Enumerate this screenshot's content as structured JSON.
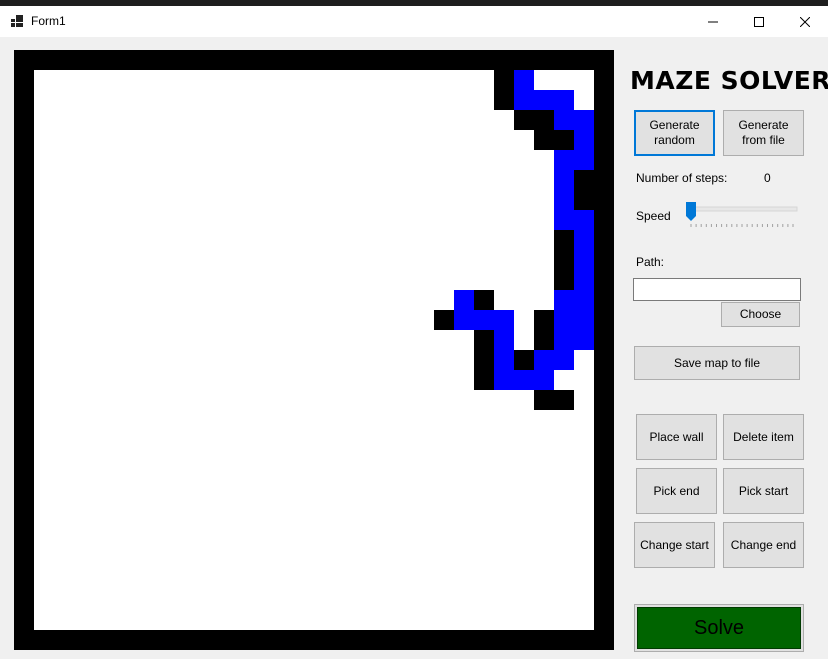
{
  "window": {
    "title": "Form1",
    "controls": {
      "minimize": "—",
      "maximize": "☐",
      "close": "✕"
    }
  },
  "maze": {
    "grid_size": 30,
    "colors": {
      "wall": "#000000",
      "path": "#0000ff",
      "empty": "#ffffff"
    },
    "walls": [
      [
        24,
        1
      ],
      [
        24,
        2
      ],
      [
        25,
        3
      ],
      [
        26,
        3
      ],
      [
        29,
        3
      ],
      [
        29,
        4
      ],
      [
        29,
        5
      ],
      [
        26,
        4
      ],
      [
        27,
        4
      ],
      [
        29,
        6
      ],
      [
        28,
        6
      ],
      [
        28,
        7
      ],
      [
        29,
        7
      ],
      [
        28,
        8
      ],
      [
        29,
        8
      ],
      [
        27,
        9
      ],
      [
        29,
        9
      ],
      [
        27,
        10
      ],
      [
        29,
        10
      ],
      [
        27,
        11
      ],
      [
        28,
        11
      ],
      [
        29,
        11
      ],
      [
        28,
        12
      ],
      [
        29,
        12
      ],
      [
        22,
        12
      ],
      [
        23,
        12
      ],
      [
        21,
        13
      ],
      [
        26,
        13
      ],
      [
        23,
        14
      ],
      [
        26,
        14
      ],
      [
        29,
        13
      ],
      [
        29,
        14
      ],
      [
        23,
        15
      ],
      [
        24,
        15
      ],
      [
        25,
        15
      ],
      [
        23,
        16
      ],
      [
        29,
        16
      ],
      [
        26,
        17
      ],
      [
        27,
        17
      ]
    ],
    "path": [
      [
        25,
        1
      ],
      [
        25,
        2
      ],
      [
        26,
        2
      ],
      [
        27,
        2
      ],
      [
        27,
        3
      ],
      [
        28,
        3
      ],
      [
        28,
        4
      ],
      [
        28,
        5
      ],
      [
        27,
        5
      ],
      [
        27,
        6
      ],
      [
        27,
        7
      ],
      [
        27,
        8
      ],
      [
        28,
        8
      ],
      [
        28,
        9
      ],
      [
        28,
        10
      ],
      [
        28,
        11
      ],
      [
        28,
        12
      ],
      [
        27,
        12
      ],
      [
        27,
        13
      ],
      [
        28,
        13
      ],
      [
        28,
        14
      ],
      [
        27,
        14
      ],
      [
        27,
        15
      ],
      [
        26,
        15
      ],
      [
        26,
        16
      ],
      [
        25,
        16
      ],
      [
        24,
        16
      ],
      [
        24,
        15
      ],
      [
        24,
        14
      ],
      [
        24,
        13
      ],
      [
        23,
        13
      ],
      [
        22,
        13
      ],
      [
        22,
        12
      ]
    ]
  },
  "sidebar": {
    "logo": "MAZE SOLVER",
    "generate_random": "Generate random",
    "generate_from_file": "Generate from file",
    "steps_label": "Number of steps:",
    "steps_value": "0",
    "speed_label": "Speed",
    "speed_value": 0,
    "path_label": "Path:",
    "path_value": "",
    "choose": "Choose",
    "save_map": "Save map to file",
    "place_wall": "Place wall",
    "delete_item": "Delete item",
    "pick_end": "Pick end",
    "pick_start": "Pick start",
    "change_start": "Change start",
    "change_end": "Change end",
    "solve": "Solve",
    "accent_color": "#0078d7",
    "solve_color": "#006400"
  }
}
